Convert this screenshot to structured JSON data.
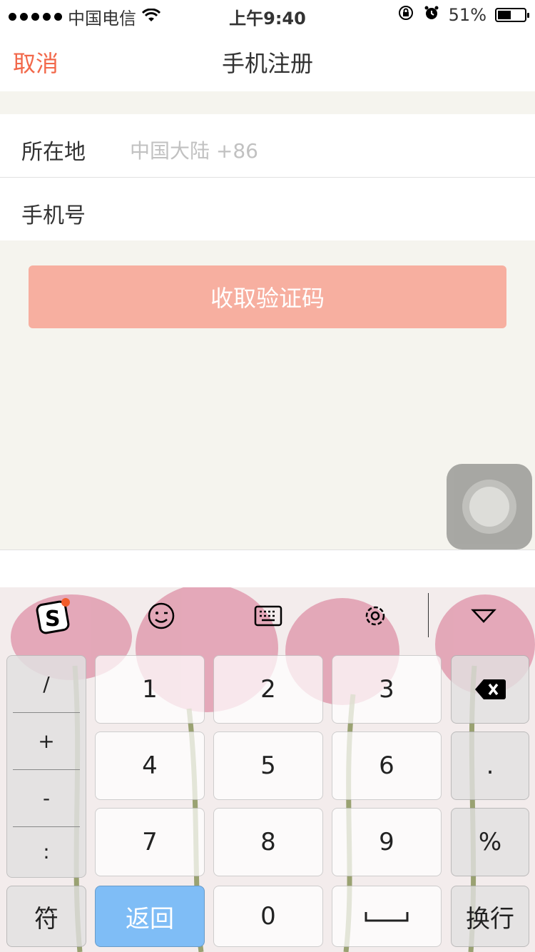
{
  "status_bar": {
    "carrier": "中国电信",
    "time": "上午9:40",
    "battery_percent": "51%",
    "battery_level": 0.51,
    "icons": [
      "signal-dots-icon",
      "wifi-icon",
      "rotation-lock-icon",
      "alarm-icon",
      "battery-icon"
    ]
  },
  "nav": {
    "cancel": "取消",
    "title": "手机注册"
  },
  "form": {
    "location_label": "所在地",
    "location_value": "中国大陆 +86",
    "phone_label": "手机号",
    "phone_value": ""
  },
  "get_code_button": "收取验证码",
  "keyboard": {
    "toolbar_icons": [
      "sogou-logo-icon",
      "emoji-icon",
      "keyboard-icon",
      "settings-gear-icon",
      "collapse-keyboard-icon"
    ],
    "symbols": [
      "/",
      "+",
      "-",
      ":"
    ],
    "digits_row1": [
      "1",
      "2",
      "3"
    ],
    "digits_row2": [
      "4",
      "5",
      "6"
    ],
    "digits_row3": [
      "7",
      "8",
      "9"
    ],
    "dot": ".",
    "percent": "%",
    "symbols_key": "符",
    "back_key": "返回",
    "zero": "0",
    "newline_key": "换行"
  },
  "colors": {
    "accent": "#f2684a",
    "button_bg": "#f7afa0",
    "page_bg": "#f5f4ee",
    "return_key": "#7fbdf6"
  }
}
